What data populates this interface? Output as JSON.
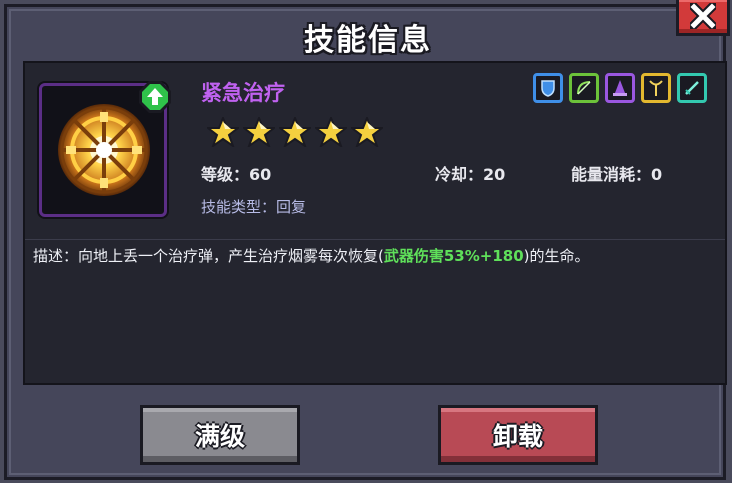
{
  "dialog": {
    "title": "技能信息",
    "close_icon": "close-x-icon"
  },
  "skill": {
    "icon": "golden-wheel-icon",
    "badge_icon": "plus-up-icon",
    "name": "紧急治疗",
    "stars": 5,
    "level_label": "等级：60",
    "cooldown_label": "冷却：20",
    "energy_label": "能量消耗：0",
    "type_label": "技能类型：回复",
    "tags": [
      {
        "icon": "shield-icon",
        "color": "#3f8fe8"
      },
      {
        "icon": "bow-icon",
        "color": "#6cc23a"
      },
      {
        "icon": "wizard-hat-icon",
        "color": "#9a57e0"
      },
      {
        "icon": "staff-icon",
        "color": "#e3b82f"
      },
      {
        "icon": "sword-icon",
        "color": "#33c9b0"
      }
    ]
  },
  "description": {
    "prefix": "描述：向地上丢一个治疗弹，产生治疗烟雾每次恢复(",
    "highlight": "武器伤害53%+180",
    "suffix": ")的生命。"
  },
  "buttons": {
    "max_label": "满级",
    "unload_label": "卸载"
  }
}
